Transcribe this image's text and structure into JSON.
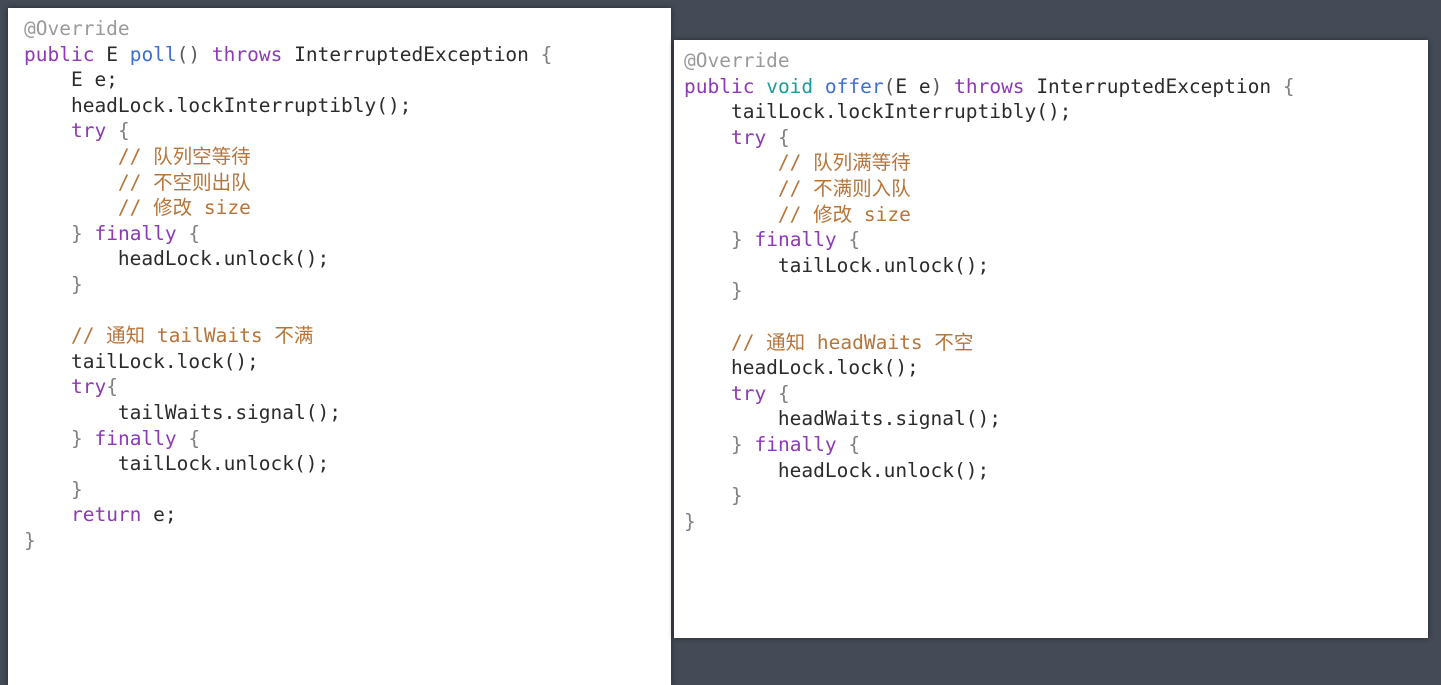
{
  "background_color": "#444b56",
  "panels": [
    {
      "id": "left",
      "name": "poll-method-code-card",
      "background": "#ffffff",
      "language": "Java",
      "code_text": "@Override\npublic E poll() throws InterruptedException {\n    E e;\n    headLock.lockInterruptibly();\n    try {\n        // 队列空等待\n        // 不空则出队\n        // 修改 size\n    } finally {\n        headLock.unlock();\n    }\n\n    // 通知 tailWaits 不满\n    tailLock.lock();\n    try{\n        tailWaits.signal();\n    } finally {\n        tailLock.unlock();\n    }\n    return e;\n}",
      "lines": [
        [
          {
            "t": "@Override",
            "c": "annot"
          }
        ],
        [
          {
            "t": "public",
            "c": "keyword"
          },
          {
            "t": " ",
            "c": "plain"
          },
          {
            "t": "E",
            "c": "plain"
          },
          {
            "t": " ",
            "c": "plain"
          },
          {
            "t": "poll",
            "c": "method"
          },
          {
            "t": "()",
            "c": "punct"
          },
          {
            "t": " ",
            "c": "plain"
          },
          {
            "t": "throws",
            "c": "keyword"
          },
          {
            "t": " ",
            "c": "plain"
          },
          {
            "t": "InterruptedException",
            "c": "plain"
          },
          {
            "t": " ",
            "c": "plain"
          },
          {
            "t": "{",
            "c": "brace"
          }
        ],
        [
          {
            "t": "    E e;",
            "c": "plain"
          }
        ],
        [
          {
            "t": "    headLock.lockInterruptibly();",
            "c": "plain"
          }
        ],
        [
          {
            "t": "    ",
            "c": "plain"
          },
          {
            "t": "try",
            "c": "keyword"
          },
          {
            "t": " ",
            "c": "plain"
          },
          {
            "t": "{",
            "c": "brace"
          }
        ],
        [
          {
            "t": "        // 队列空等待",
            "c": "comment"
          }
        ],
        [
          {
            "t": "        // 不空则出队",
            "c": "comment"
          }
        ],
        [
          {
            "t": "        // 修改 size",
            "c": "comment"
          }
        ],
        [
          {
            "t": "    ",
            "c": "plain"
          },
          {
            "t": "}",
            "c": "brace"
          },
          {
            "t": " ",
            "c": "plain"
          },
          {
            "t": "finally",
            "c": "keyword"
          },
          {
            "t": " ",
            "c": "plain"
          },
          {
            "t": "{",
            "c": "brace"
          }
        ],
        [
          {
            "t": "        headLock.unlock();",
            "c": "plain"
          }
        ],
        [
          {
            "t": "    ",
            "c": "plain"
          },
          {
            "t": "}",
            "c": "brace"
          }
        ],
        [
          {
            "t": "",
            "c": "plain"
          }
        ],
        [
          {
            "t": "    // 通知 tailWaits 不满",
            "c": "comment"
          }
        ],
        [
          {
            "t": "    tailLock.lock();",
            "c": "plain"
          }
        ],
        [
          {
            "t": "    ",
            "c": "plain"
          },
          {
            "t": "try",
            "c": "keyword"
          },
          {
            "t": "{",
            "c": "brace"
          }
        ],
        [
          {
            "t": "        tailWaits.signal();",
            "c": "plain"
          }
        ],
        [
          {
            "t": "    ",
            "c": "plain"
          },
          {
            "t": "}",
            "c": "brace"
          },
          {
            "t": " ",
            "c": "plain"
          },
          {
            "t": "finally",
            "c": "keyword"
          },
          {
            "t": " ",
            "c": "plain"
          },
          {
            "t": "{",
            "c": "brace"
          }
        ],
        [
          {
            "t": "        tailLock.unlock();",
            "c": "plain"
          }
        ],
        [
          {
            "t": "    ",
            "c": "plain"
          },
          {
            "t": "}",
            "c": "brace"
          }
        ],
        [
          {
            "t": "    ",
            "c": "plain"
          },
          {
            "t": "return",
            "c": "keyword"
          },
          {
            "t": " e;",
            "c": "plain"
          }
        ],
        [
          {
            "t": "}",
            "c": "brace"
          }
        ]
      ]
    },
    {
      "id": "right",
      "name": "offer-method-code-card",
      "background": "#ffffff",
      "language": "Java",
      "code_text": "@Override\npublic void offer(E e) throws InterruptedException {\n    tailLock.lockInterruptibly();\n    try {\n        // 队列满等待\n        // 不满则入队\n        // 修改 size\n    } finally {\n        tailLock.unlock();\n    }\n\n    // 通知 headWaits 不空\n    headLock.lock();\n    try {\n        headWaits.signal();\n    } finally {\n        headLock.unlock();\n    }\n}",
      "lines": [
        [
          {
            "t": "@Override",
            "c": "annot"
          }
        ],
        [
          {
            "t": "public",
            "c": "keyword"
          },
          {
            "t": " ",
            "c": "plain"
          },
          {
            "t": "void",
            "c": "type"
          },
          {
            "t": " ",
            "c": "plain"
          },
          {
            "t": "offer",
            "c": "method"
          },
          {
            "t": "(",
            "c": "punct"
          },
          {
            "t": "E e",
            "c": "plain"
          },
          {
            "t": ")",
            "c": "punct"
          },
          {
            "t": " ",
            "c": "plain"
          },
          {
            "t": "throws",
            "c": "keyword"
          },
          {
            "t": " ",
            "c": "plain"
          },
          {
            "t": "InterruptedException",
            "c": "plain"
          },
          {
            "t": " ",
            "c": "plain"
          },
          {
            "t": "{",
            "c": "brace"
          }
        ],
        [
          {
            "t": "    tailLock.lockInterruptibly();",
            "c": "plain"
          }
        ],
        [
          {
            "t": "    ",
            "c": "plain"
          },
          {
            "t": "try",
            "c": "keyword"
          },
          {
            "t": " ",
            "c": "plain"
          },
          {
            "t": "{",
            "c": "brace"
          }
        ],
        [
          {
            "t": "        // 队列满等待",
            "c": "comment"
          }
        ],
        [
          {
            "t": "        // 不满则入队",
            "c": "comment"
          }
        ],
        [
          {
            "t": "        // 修改 size",
            "c": "comment"
          }
        ],
        [
          {
            "t": "    ",
            "c": "plain"
          },
          {
            "t": "}",
            "c": "brace"
          },
          {
            "t": " ",
            "c": "plain"
          },
          {
            "t": "finally",
            "c": "keyword"
          },
          {
            "t": " ",
            "c": "plain"
          },
          {
            "t": "{",
            "c": "brace"
          }
        ],
        [
          {
            "t": "        tailLock.unlock();",
            "c": "plain"
          }
        ],
        [
          {
            "t": "    ",
            "c": "plain"
          },
          {
            "t": "}",
            "c": "brace"
          }
        ],
        [
          {
            "t": "",
            "c": "plain"
          }
        ],
        [
          {
            "t": "    // 通知 headWaits 不空",
            "c": "comment"
          }
        ],
        [
          {
            "t": "    headLock.lock();",
            "c": "plain"
          }
        ],
        [
          {
            "t": "    ",
            "c": "plain"
          },
          {
            "t": "try",
            "c": "keyword"
          },
          {
            "t": " ",
            "c": "plain"
          },
          {
            "t": "{",
            "c": "brace"
          }
        ],
        [
          {
            "t": "        headWaits.signal();",
            "c": "plain"
          }
        ],
        [
          {
            "t": "    ",
            "c": "plain"
          },
          {
            "t": "}",
            "c": "brace"
          },
          {
            "t": " ",
            "c": "plain"
          },
          {
            "t": "finally",
            "c": "keyword"
          },
          {
            "t": " ",
            "c": "plain"
          },
          {
            "t": "{",
            "c": "brace"
          }
        ],
        [
          {
            "t": "        headLock.unlock();",
            "c": "plain"
          }
        ],
        [
          {
            "t": "    ",
            "c": "plain"
          },
          {
            "t": "}",
            "c": "brace"
          }
        ],
        [
          {
            "t": "}",
            "c": "brace"
          }
        ]
      ]
    }
  ],
  "token_colors": {
    "plain": "#2b2b2b",
    "keyword": "#8c3ab5",
    "method": "#3b6fd4",
    "type": "#1d9a9a",
    "comment": "#b5753b",
    "annot": "#9a9a9a",
    "punct": "#5a5a5a",
    "brace": "#808080"
  }
}
